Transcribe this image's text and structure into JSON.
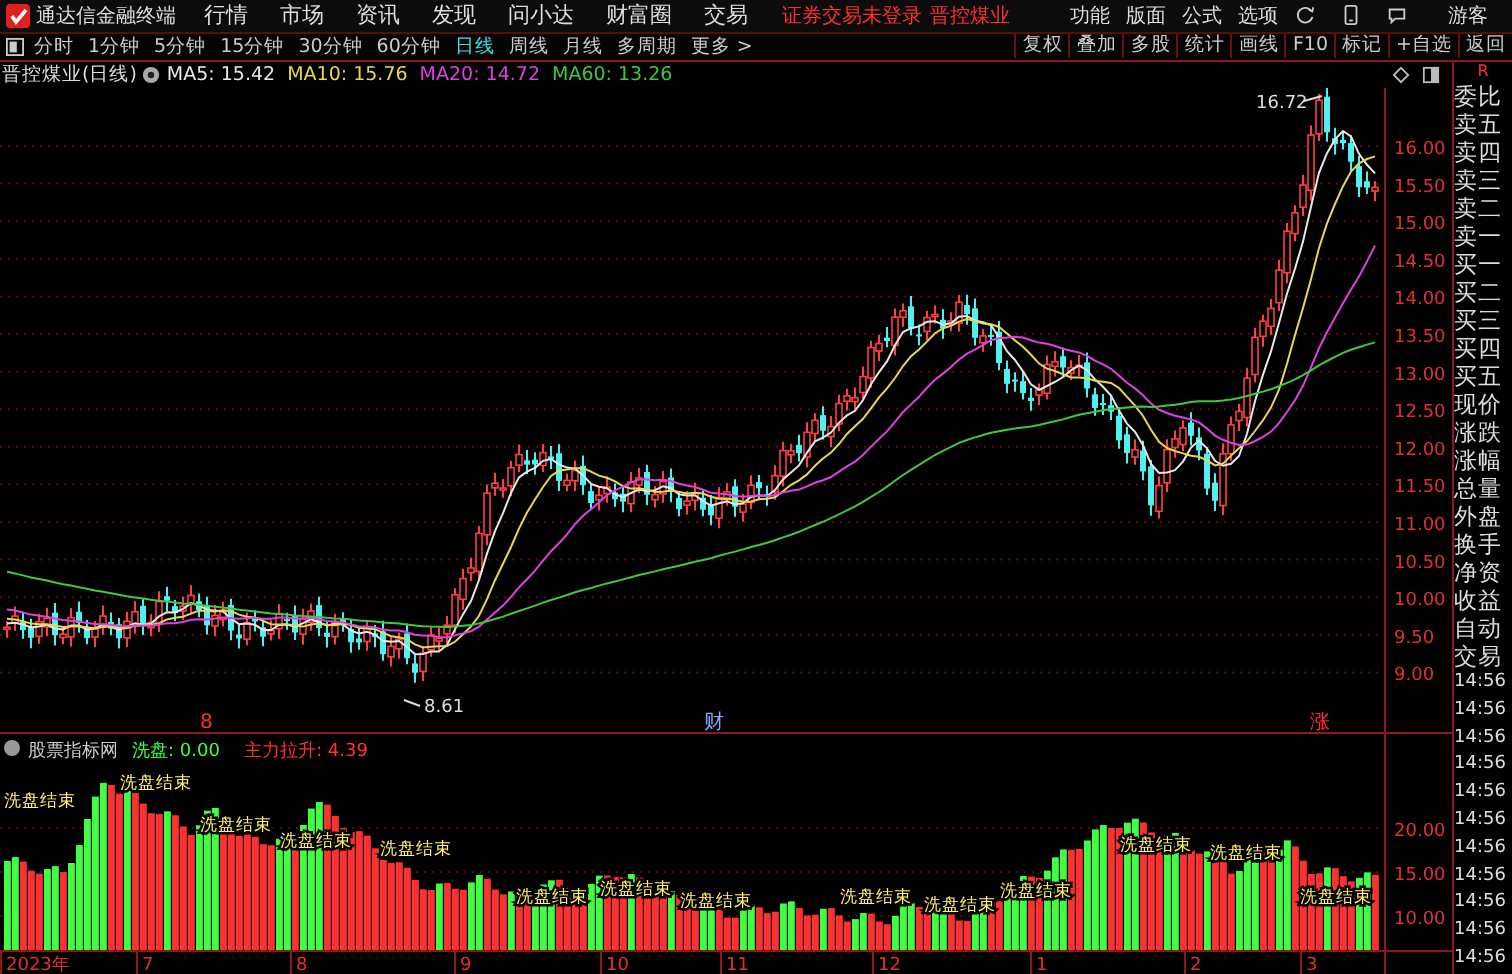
{
  "menu_bar": {
    "app_title": "通达信金融终端",
    "menus": [
      "行情",
      "市场",
      "资讯",
      "发现",
      "问小达",
      "财富圈",
      "交易"
    ],
    "login_status": "证券交易未登录",
    "stock_name": "晋控煤业",
    "actions": [
      "功能",
      "版面",
      "公式",
      "选项"
    ],
    "user": "游客"
  },
  "period_bar": {
    "periods": [
      {
        "label": "分时",
        "selected": false
      },
      {
        "label": "1分钟",
        "selected": false
      },
      {
        "label": "5分钟",
        "selected": false
      },
      {
        "label": "15分钟",
        "selected": false
      },
      {
        "label": "30分钟",
        "selected": false
      },
      {
        "label": "60分钟",
        "selected": false
      },
      {
        "label": "日线",
        "selected": true
      },
      {
        "label": "周线",
        "selected": false
      },
      {
        "label": "月线",
        "selected": false
      },
      {
        "label": "多周期",
        "selected": false
      },
      {
        "label": "更多 >",
        "selected": false
      }
    ],
    "tools": [
      "复权",
      "叠加",
      "多股",
      "统计",
      "画线",
      "F10",
      "标记",
      "+自选",
      "返回"
    ]
  },
  "chart_header": {
    "title": "晋控煤业(日线)",
    "indicators": [
      {
        "label": "MA5: 15.42",
        "color": "#e8e8e8"
      },
      {
        "label": "MA10: 15.76",
        "color": "#e8d850"
      },
      {
        "label": "MA20: 14.72",
        "color": "#e040e0"
      },
      {
        "label": "MA60: 13.26",
        "color": "#40c840"
      }
    ]
  },
  "price_chart": {
    "high_label": "16.72",
    "low_label": "8.61",
    "axis_labels": [
      "16.00",
      "15.50",
      "15.00",
      "14.50",
      "14.00",
      "13.50",
      "13.00",
      "12.50",
      "12.00",
      "11.50",
      "11.00",
      "10.50",
      "10.00",
      "9.50",
      "9.00"
    ],
    "event_marks": [
      {
        "text": "8",
        "kind": "alert"
      },
      {
        "text": "财",
        "kind": "finance"
      },
      {
        "text": "涨",
        "kind": "alert"
      }
    ]
  },
  "indicator_panel": {
    "name": "股票指标网",
    "values": [
      {
        "label": "洗盘: 0.00",
        "color": "#40ff40"
      },
      {
        "label": "主力拉升: 4.39",
        "color": "#ff3030"
      }
    ],
    "signal_labels": [
      "洗盘结束",
      "洗盘结束",
      "洗盘结束",
      "洗盘结束",
      "洗盘结束",
      "洗盘结束",
      "洗盘结束",
      "洗盘结束",
      "洗盘结束",
      "洗盘结束",
      "洗盘结束",
      "洗盘结束",
      "洗盘结束",
      "洗盘结束"
    ],
    "axis_labels": [
      "20.00",
      "15.00",
      "10.00"
    ]
  },
  "date_axis": [
    "2023年",
    "7",
    "8",
    "9",
    "10",
    "11",
    "12",
    "1",
    "2",
    "3"
  ],
  "quote_panel": {
    "marker": "R",
    "fields": [
      "委比",
      "卖五",
      "卖四",
      "卖三",
      "卖二",
      "卖一",
      "买一",
      "买二",
      "买三",
      "买四",
      "买五",
      "现价",
      "涨跌",
      "涨幅",
      "总量",
      "外盘",
      "换手",
      "净资",
      "收益",
      "自动",
      "交易"
    ],
    "trade_times": [
      "14:56",
      "14:56",
      "14:56",
      "14:56",
      "14:56",
      "14:56",
      "14:56",
      "14:56",
      "14:56",
      "14:56",
      "14:56"
    ]
  }
}
